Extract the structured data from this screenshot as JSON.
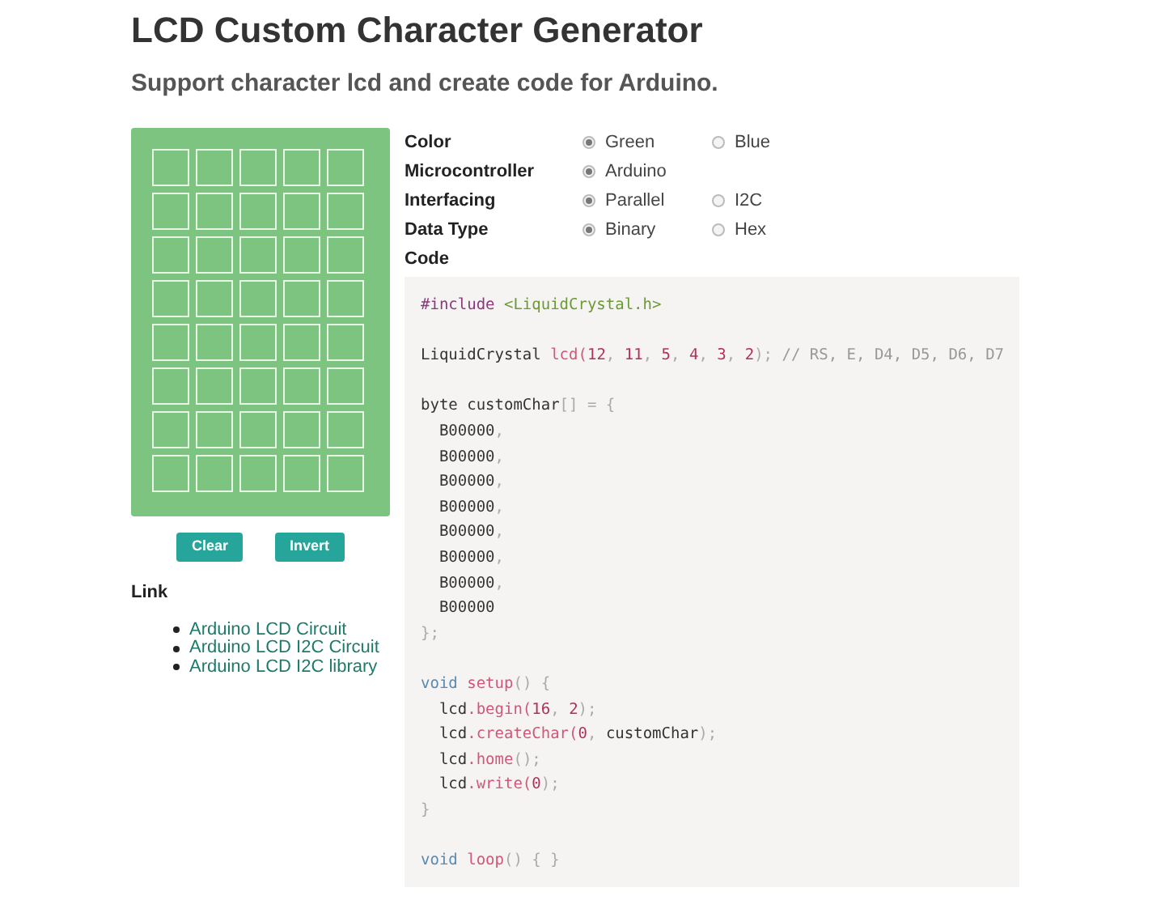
{
  "title": "LCD Custom Character Generator",
  "subtitle": "Support character lcd and create code for Arduino.",
  "pixels": [
    [
      {
        "on": false
      },
      {
        "on": false
      },
      {
        "on": false
      },
      {
        "on": false
      },
      {
        "on": false
      }
    ],
    [
      {
        "on": false
      },
      {
        "on": false
      },
      {
        "on": false
      },
      {
        "on": false
      },
      {
        "on": false
      }
    ],
    [
      {
        "on": false
      },
      {
        "on": false
      },
      {
        "on": false
      },
      {
        "on": false
      },
      {
        "on": false
      }
    ],
    [
      {
        "on": false
      },
      {
        "on": false
      },
      {
        "on": false
      },
      {
        "on": false
      },
      {
        "on": false
      }
    ],
    [
      {
        "on": false
      },
      {
        "on": false
      },
      {
        "on": false
      },
      {
        "on": false
      },
      {
        "on": false
      }
    ],
    [
      {
        "on": false
      },
      {
        "on": false
      },
      {
        "on": false
      },
      {
        "on": false
      },
      {
        "on": false
      }
    ],
    [
      {
        "on": false
      },
      {
        "on": false
      },
      {
        "on": false
      },
      {
        "on": false
      },
      {
        "on": false
      }
    ],
    [
      {
        "on": false
      },
      {
        "on": false
      },
      {
        "on": false
      },
      {
        "on": false
      },
      {
        "on": false
      }
    ]
  ],
  "buttons": [
    "Clear",
    "Invert"
  ],
  "links_heading": "Link",
  "links": [
    "Arduino LCD Circuit",
    "Arduino LCD I2C Circuit",
    "Arduino LCD I2C library"
  ],
  "options": [
    {
      "label": "Color",
      "choices": [
        {
          "label": "Green",
          "selected": true
        },
        {
          "label": "Blue",
          "selected": false
        }
      ]
    },
    {
      "label": "Microcontroller",
      "choices": [
        {
          "label": "Arduino",
          "selected": true
        }
      ]
    },
    {
      "label": "Interfacing",
      "choices": [
        {
          "label": "Parallel",
          "selected": true
        },
        {
          "label": "I2C",
          "selected": false
        }
      ]
    },
    {
      "label": "Data Type",
      "choices": [
        {
          "label": "Binary",
          "selected": true
        },
        {
          "label": "Hex",
          "selected": false
        }
      ]
    }
  ],
  "code_label": "Code",
  "code_blocks": [
    [
      [
        {
          "kind": "directive",
          "text": "#include "
        },
        {
          "kind": "string",
          "text": "<LiquidCrystal.h>"
        }
      ]
    ],
    [
      [
        {
          "kind": "plain",
          "text": "LiquidCrystal "
        },
        {
          "kind": "func",
          "text": "lcd("
        },
        {
          "kind": "number",
          "text": "12"
        },
        {
          "kind": "punct",
          "text": ", "
        },
        {
          "kind": "number",
          "text": "11"
        },
        {
          "kind": "punct",
          "text": ", "
        },
        {
          "kind": "number",
          "text": "5"
        },
        {
          "kind": "punct",
          "text": ", "
        },
        {
          "kind": "number",
          "text": "4"
        },
        {
          "kind": "punct",
          "text": ", "
        },
        {
          "kind": "number",
          "text": "3"
        },
        {
          "kind": "punct",
          "text": ", "
        },
        {
          "kind": "number",
          "text": "2"
        },
        {
          "kind": "punct",
          "text": "); "
        },
        {
          "kind": "comment",
          "text": "// RS, E, D4, D5, D6, D7"
        }
      ]
    ],
    [
      [
        {
          "kind": "plain",
          "text": "byte customChar"
        },
        {
          "kind": "punct",
          "text": "[] = {"
        }
      ],
      [
        {
          "kind": "plain",
          "text": "  B00000"
        },
        {
          "kind": "punct",
          "text": ","
        }
      ],
      [
        {
          "kind": "plain",
          "text": "  B00000"
        },
        {
          "kind": "punct",
          "text": ","
        }
      ],
      [
        {
          "kind": "plain",
          "text": "  B00000"
        },
        {
          "kind": "punct",
          "text": ","
        }
      ],
      [
        {
          "kind": "plain",
          "text": "  B00000"
        },
        {
          "kind": "punct",
          "text": ","
        }
      ],
      [
        {
          "kind": "plain",
          "text": "  B00000"
        },
        {
          "kind": "punct",
          "text": ","
        }
      ],
      [
        {
          "kind": "plain",
          "text": "  B00000"
        },
        {
          "kind": "punct",
          "text": ","
        }
      ],
      [
        {
          "kind": "plain",
          "text": "  B00000"
        },
        {
          "kind": "punct",
          "text": ","
        }
      ],
      [
        {
          "kind": "plain",
          "text": "  B00000"
        }
      ],
      [
        {
          "kind": "punct",
          "text": "};"
        }
      ]
    ],
    [
      [
        {
          "kind": "type",
          "text": "void "
        },
        {
          "kind": "func",
          "text": "setup"
        },
        {
          "kind": "punct",
          "text": "() {"
        }
      ],
      [
        {
          "kind": "plain",
          "text": "  lcd"
        },
        {
          "kind": "func",
          "text": ".begin("
        },
        {
          "kind": "number",
          "text": "16"
        },
        {
          "kind": "punct",
          "text": ", "
        },
        {
          "kind": "number",
          "text": "2"
        },
        {
          "kind": "punct",
          "text": ");"
        }
      ],
      [
        {
          "kind": "plain",
          "text": "  lcd"
        },
        {
          "kind": "func",
          "text": ".createChar("
        },
        {
          "kind": "number",
          "text": "0"
        },
        {
          "kind": "punct",
          "text": ", "
        },
        {
          "kind": "plain",
          "text": "customChar"
        },
        {
          "kind": "punct",
          "text": ");"
        }
      ],
      [
        {
          "kind": "plain",
          "text": "  lcd"
        },
        {
          "kind": "func",
          "text": ".home"
        },
        {
          "kind": "punct",
          "text": "();"
        }
      ],
      [
        {
          "kind": "plain",
          "text": "  lcd"
        },
        {
          "kind": "func",
          "text": ".write("
        },
        {
          "kind": "number",
          "text": "0"
        },
        {
          "kind": "punct",
          "text": ");"
        }
      ],
      [
        {
          "kind": "punct",
          "text": "}"
        }
      ]
    ],
    [
      [
        {
          "kind": "type",
          "text": "void "
        },
        {
          "kind": "func",
          "text": "loop"
        },
        {
          "kind": "punct",
          "text": "() { }"
        }
      ]
    ]
  ]
}
